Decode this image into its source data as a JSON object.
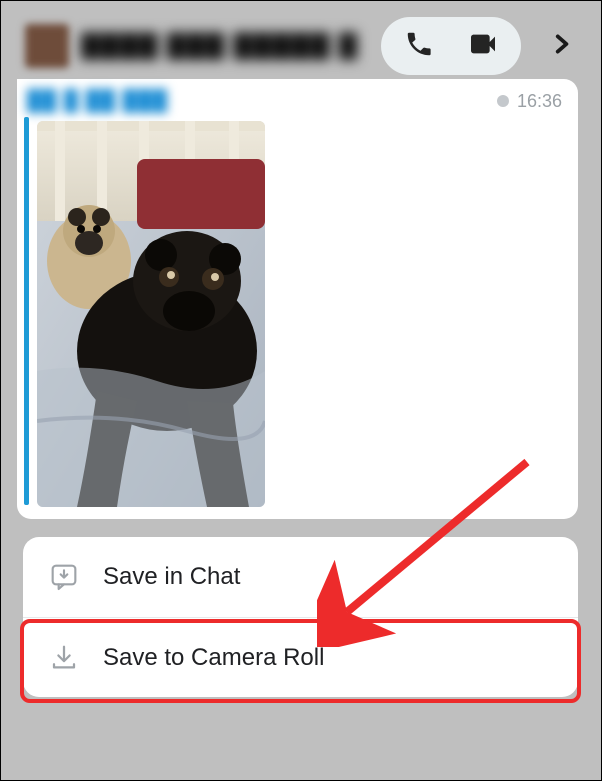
{
  "header": {
    "chat_name": "████ ███ █████ █",
    "avatar_color": "#6e4c3a"
  },
  "message": {
    "sender": "██ █ ██ ███",
    "timestamp": "16:36"
  },
  "actions": {
    "save_in_chat": "Save in Chat",
    "save_to_camera_roll": "Save to Camera Roll"
  },
  "icons": {
    "phone": "phone-icon",
    "video": "video-icon",
    "chevron": "chevron-right-icon",
    "save_chat": "chat-download-icon",
    "download": "download-icon"
  }
}
